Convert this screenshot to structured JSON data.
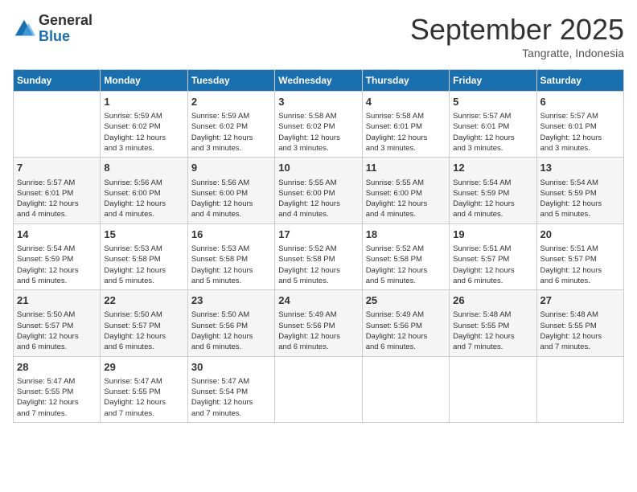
{
  "logo": {
    "general": "General",
    "blue": "Blue"
  },
  "header": {
    "month": "September 2025",
    "location": "Tangratte, Indonesia"
  },
  "days_of_week": [
    "Sunday",
    "Monday",
    "Tuesday",
    "Wednesday",
    "Thursday",
    "Friday",
    "Saturday"
  ],
  "weeks": [
    [
      {
        "day": "",
        "info": ""
      },
      {
        "day": "1",
        "info": "Sunrise: 5:59 AM\nSunset: 6:02 PM\nDaylight: 12 hours\nand 3 minutes."
      },
      {
        "day": "2",
        "info": "Sunrise: 5:59 AM\nSunset: 6:02 PM\nDaylight: 12 hours\nand 3 minutes."
      },
      {
        "day": "3",
        "info": "Sunrise: 5:58 AM\nSunset: 6:02 PM\nDaylight: 12 hours\nand 3 minutes."
      },
      {
        "day": "4",
        "info": "Sunrise: 5:58 AM\nSunset: 6:01 PM\nDaylight: 12 hours\nand 3 minutes."
      },
      {
        "day": "5",
        "info": "Sunrise: 5:57 AM\nSunset: 6:01 PM\nDaylight: 12 hours\nand 3 minutes."
      },
      {
        "day": "6",
        "info": "Sunrise: 5:57 AM\nSunset: 6:01 PM\nDaylight: 12 hours\nand 3 minutes."
      }
    ],
    [
      {
        "day": "7",
        "info": "Sunrise: 5:57 AM\nSunset: 6:01 PM\nDaylight: 12 hours\nand 4 minutes."
      },
      {
        "day": "8",
        "info": "Sunrise: 5:56 AM\nSunset: 6:00 PM\nDaylight: 12 hours\nand 4 minutes."
      },
      {
        "day": "9",
        "info": "Sunrise: 5:56 AM\nSunset: 6:00 PM\nDaylight: 12 hours\nand 4 minutes."
      },
      {
        "day": "10",
        "info": "Sunrise: 5:55 AM\nSunset: 6:00 PM\nDaylight: 12 hours\nand 4 minutes."
      },
      {
        "day": "11",
        "info": "Sunrise: 5:55 AM\nSunset: 6:00 PM\nDaylight: 12 hours\nand 4 minutes."
      },
      {
        "day": "12",
        "info": "Sunrise: 5:54 AM\nSunset: 5:59 PM\nDaylight: 12 hours\nand 4 minutes."
      },
      {
        "day": "13",
        "info": "Sunrise: 5:54 AM\nSunset: 5:59 PM\nDaylight: 12 hours\nand 5 minutes."
      }
    ],
    [
      {
        "day": "14",
        "info": "Sunrise: 5:54 AM\nSunset: 5:59 PM\nDaylight: 12 hours\nand 5 minutes."
      },
      {
        "day": "15",
        "info": "Sunrise: 5:53 AM\nSunset: 5:58 PM\nDaylight: 12 hours\nand 5 minutes."
      },
      {
        "day": "16",
        "info": "Sunrise: 5:53 AM\nSunset: 5:58 PM\nDaylight: 12 hours\nand 5 minutes."
      },
      {
        "day": "17",
        "info": "Sunrise: 5:52 AM\nSunset: 5:58 PM\nDaylight: 12 hours\nand 5 minutes."
      },
      {
        "day": "18",
        "info": "Sunrise: 5:52 AM\nSunset: 5:58 PM\nDaylight: 12 hours\nand 5 minutes."
      },
      {
        "day": "19",
        "info": "Sunrise: 5:51 AM\nSunset: 5:57 PM\nDaylight: 12 hours\nand 6 minutes."
      },
      {
        "day": "20",
        "info": "Sunrise: 5:51 AM\nSunset: 5:57 PM\nDaylight: 12 hours\nand 6 minutes."
      }
    ],
    [
      {
        "day": "21",
        "info": "Sunrise: 5:50 AM\nSunset: 5:57 PM\nDaylight: 12 hours\nand 6 minutes."
      },
      {
        "day": "22",
        "info": "Sunrise: 5:50 AM\nSunset: 5:57 PM\nDaylight: 12 hours\nand 6 minutes."
      },
      {
        "day": "23",
        "info": "Sunrise: 5:50 AM\nSunset: 5:56 PM\nDaylight: 12 hours\nand 6 minutes."
      },
      {
        "day": "24",
        "info": "Sunrise: 5:49 AM\nSunset: 5:56 PM\nDaylight: 12 hours\nand 6 minutes."
      },
      {
        "day": "25",
        "info": "Sunrise: 5:49 AM\nSunset: 5:56 PM\nDaylight: 12 hours\nand 6 minutes."
      },
      {
        "day": "26",
        "info": "Sunrise: 5:48 AM\nSunset: 5:55 PM\nDaylight: 12 hours\nand 7 minutes."
      },
      {
        "day": "27",
        "info": "Sunrise: 5:48 AM\nSunset: 5:55 PM\nDaylight: 12 hours\nand 7 minutes."
      }
    ],
    [
      {
        "day": "28",
        "info": "Sunrise: 5:47 AM\nSunset: 5:55 PM\nDaylight: 12 hours\nand 7 minutes."
      },
      {
        "day": "29",
        "info": "Sunrise: 5:47 AM\nSunset: 5:55 PM\nDaylight: 12 hours\nand 7 minutes."
      },
      {
        "day": "30",
        "info": "Sunrise: 5:47 AM\nSunset: 5:54 PM\nDaylight: 12 hours\nand 7 minutes."
      },
      {
        "day": "",
        "info": ""
      },
      {
        "day": "",
        "info": ""
      },
      {
        "day": "",
        "info": ""
      },
      {
        "day": "",
        "info": ""
      }
    ]
  ]
}
